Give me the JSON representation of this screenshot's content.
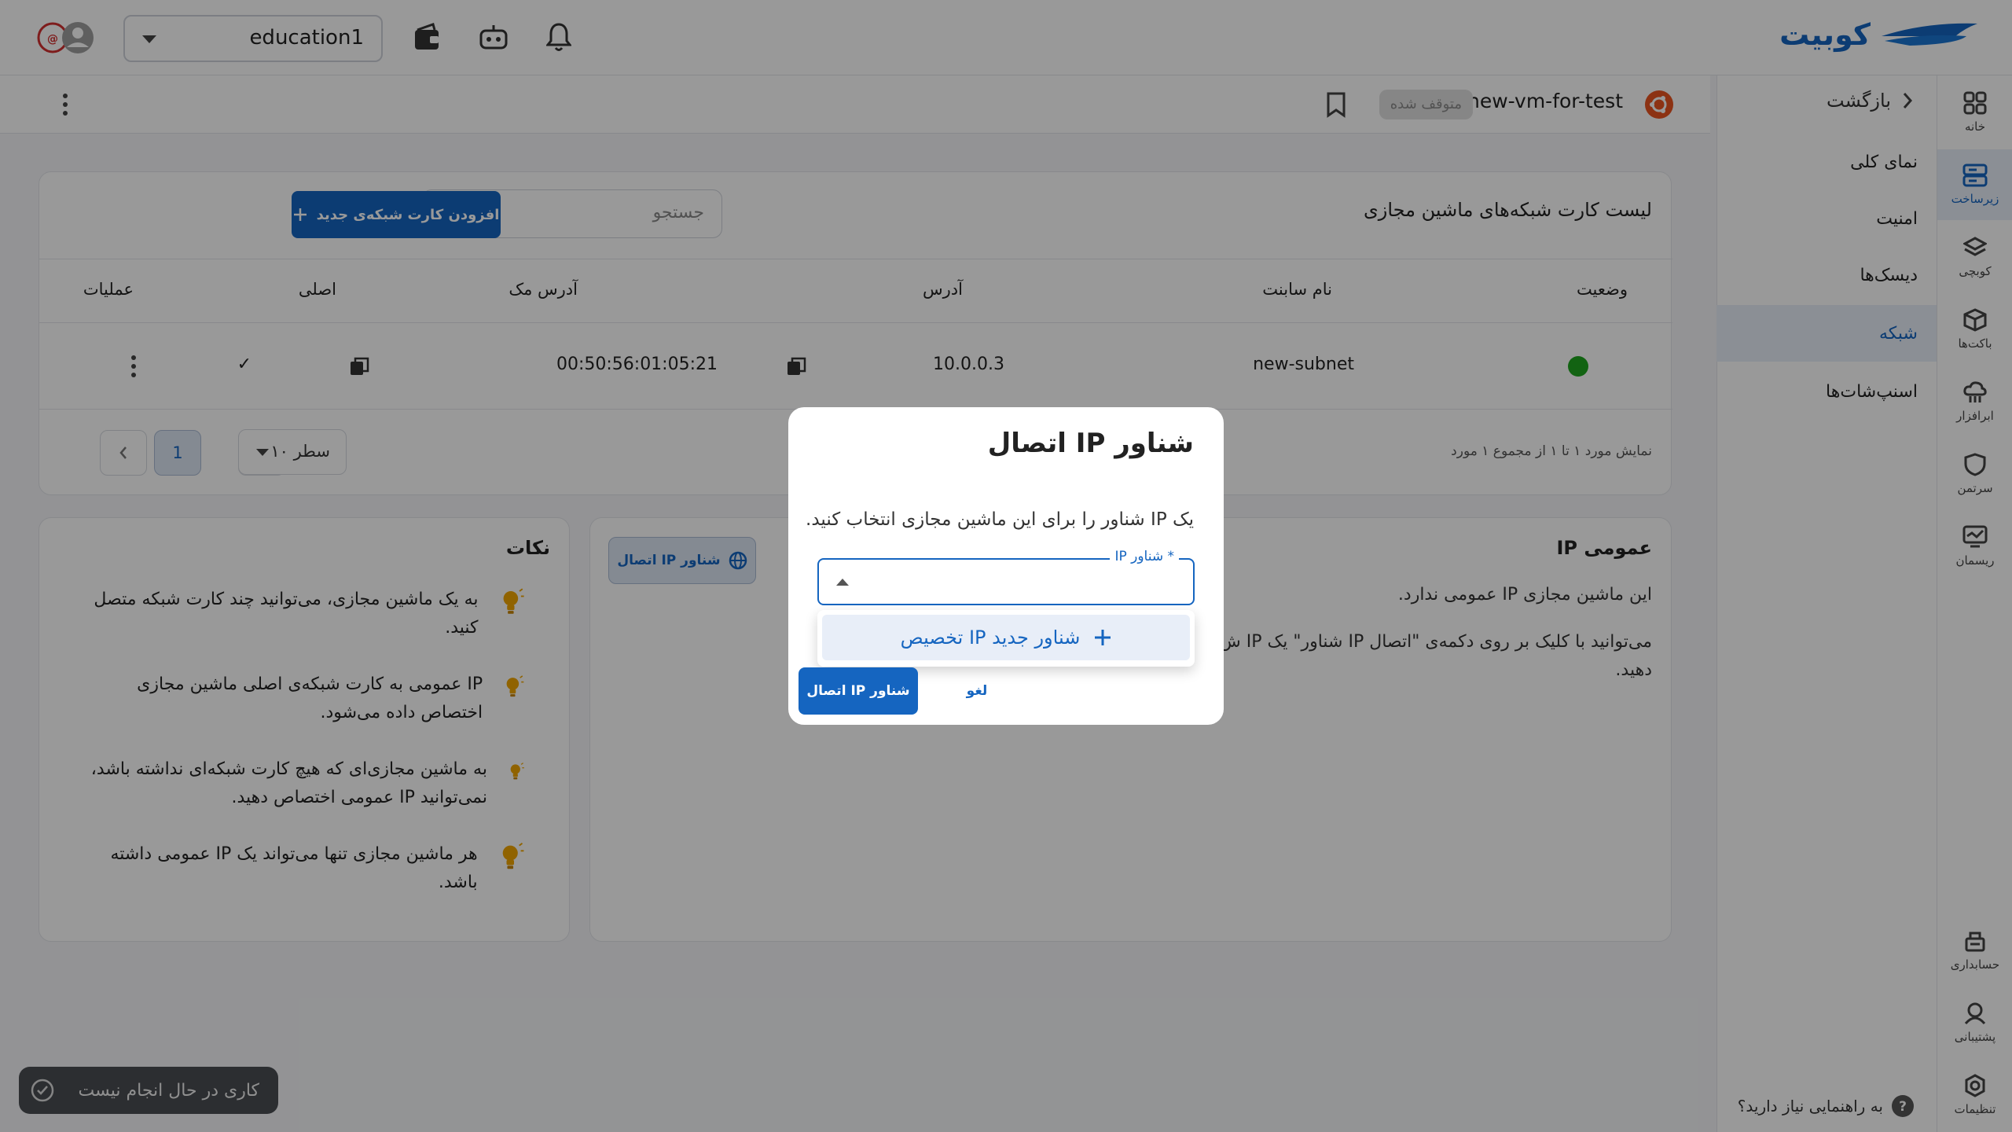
{
  "topbar": {
    "brand": "کوبیت",
    "workspace": "education1"
  },
  "rail": [
    {
      "label": "خانه",
      "icon": "grid-icon"
    },
    {
      "label": "زیرساخت",
      "icon": "server-icon"
    },
    {
      "label": "کوبچی",
      "icon": "layers-icon"
    },
    {
      "label": "باکت‌ها",
      "icon": "box-icon"
    },
    {
      "label": "ابرافزار",
      "icon": "cloud-app-icon"
    },
    {
      "label": "سرتمن",
      "icon": "shield-icon"
    },
    {
      "label": "ریسمان",
      "icon": "monitor-icon"
    },
    {
      "label": "حسابداری",
      "icon": "accounting-icon"
    },
    {
      "label": "پشتیبانی",
      "icon": "support-icon"
    },
    {
      "label": "تنظیمات",
      "icon": "settings-icon"
    }
  ],
  "subnav": {
    "back": "بازگشت",
    "items": [
      "نمای کلی",
      "امنیت",
      "دیسک‌ها",
      "شبکه",
      "اسنپ‌شات‌ها"
    ],
    "help": "به راهنمایی نیاز دارید؟"
  },
  "vm": {
    "name": "new-vm-for-test",
    "status": "متوقف شده"
  },
  "table_card": {
    "title": "لیست کارت شبکه‌های ماشین مجازی",
    "search_placeholder": "جستجو",
    "add_button": "افزودن کارت شبکه‌ی جدید",
    "columns": [
      "وضعیت",
      "نام سابنت",
      "آدرس",
      "آدرس مک",
      "اصلی",
      "عملیات"
    ],
    "rows": [
      {
        "subnet": "new-subnet",
        "address": "10.0.0.3",
        "mac": "00:50:56:01:05:21",
        "primary": "✓"
      }
    ],
    "pager_info": "نمایش مورد ۱ تا ۱ از مجموع ۱ مورد",
    "rows_per_page": "۱۰ سطر",
    "current_page": "1"
  },
  "ip_card": {
    "title": "IP عمومی",
    "line1": "این ماشین مجازی IP عمومی ندارد.",
    "line2": "می‌توانید با کلیک بر روی دکمه‌ی \"اتصال IP شناور\" یک IP ش",
    "line3": "دهید.",
    "button": "اتصال IP شناور"
  },
  "tips": {
    "title": "نکات",
    "items": [
      "به یک ماشین مجازی، می‌توانید چند کارت شبکه متصل کنید.",
      "IP عمومی به کارت شبکه‌ی اصلی ماشین مجازی اختصاص داده می‌شود.",
      "به ماشین مجازی‌ای که هیچ کارت شبکه‌ای نداشته باشد، نمی‌توانید IP عمومی اختصاص دهید.",
      "هر ماشین مجازی تنها می‌تواند یک IP عمومی داشته باشد."
    ]
  },
  "toast": "کاری در حال انجام نیست",
  "modal": {
    "title": "اتصال IP شناور",
    "description": "یک IP شناور را برای این ماشین مجازی انتخاب کنید.",
    "field_label": "IP شناور *",
    "dropdown_option": "تخصیص IP شناور جدید",
    "confirm": "اتصال IP شناور",
    "cancel": "لغو"
  }
}
